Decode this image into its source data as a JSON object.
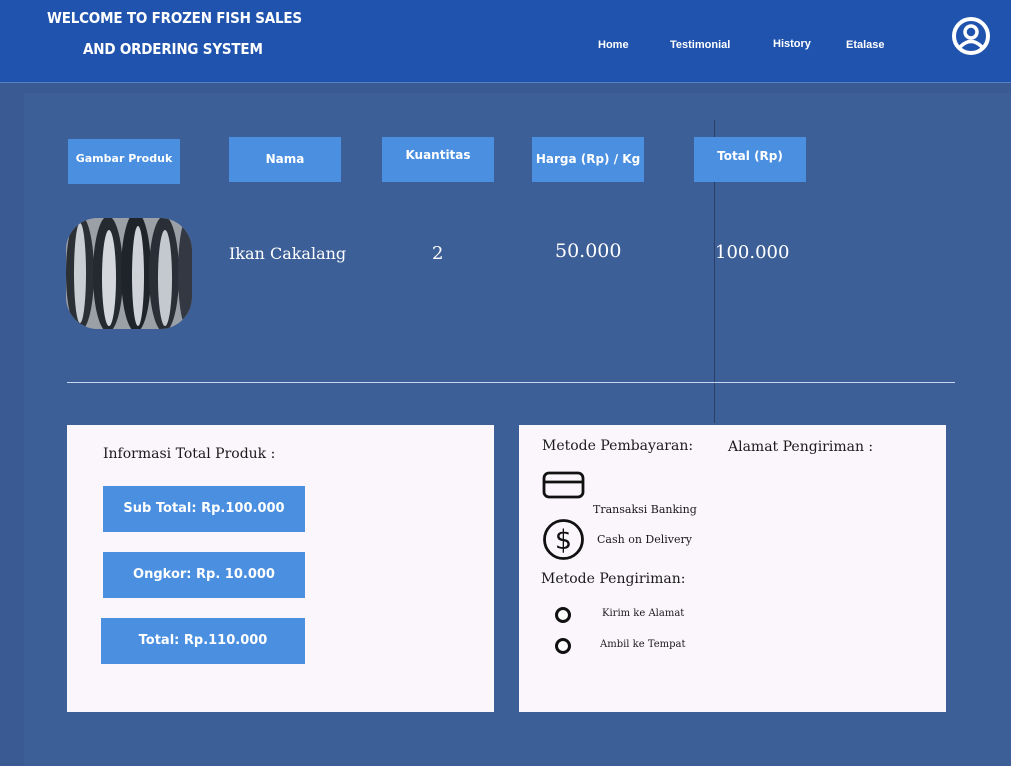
{
  "header": {
    "title_line1": "WELCOME TO FROZEN FISH SALES",
    "title_line2": "AND ORDERING SYSTEM",
    "nav": [
      "Home",
      "Testimonial",
      "History",
      "Etalase"
    ]
  },
  "table": {
    "headers": [
      "Gambar Produk",
      "Nama",
      "Kuantitas",
      "Harga (Rp) / Kg",
      "Total (Rp)"
    ],
    "row": {
      "name": "Ikan Cakalang",
      "quantity": "2",
      "price": "50.000",
      "total": "100.000"
    }
  },
  "summary": {
    "heading": "Informasi Total Produk :",
    "subtotal": "Sub Total: Rp.100.000",
    "shipping": "Ongkor: Rp. 10.000",
    "total": "Total: Rp.110.000"
  },
  "payment": {
    "heading": "Metode Pembayaran:",
    "options": [
      "Transaksi Banking",
      "Cash on Delivery"
    ]
  },
  "address": {
    "heading": "Alamat Pengiriman :"
  },
  "delivery": {
    "heading": "Metode Pengiriman:",
    "options": [
      "Kirim ke Alamat",
      "Ambil ke Tempat"
    ]
  }
}
